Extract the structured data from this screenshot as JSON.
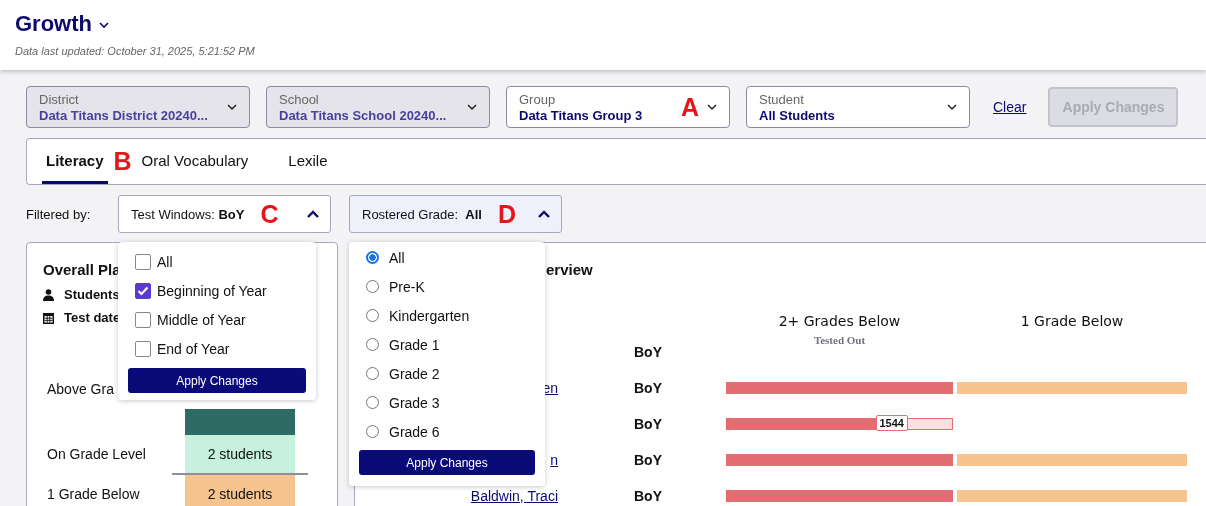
{
  "header": {
    "title": "Growth",
    "updated": "Data last updated: October 31, 2025, 5:21:52 PM"
  },
  "selectors": [
    {
      "label": "District",
      "value": "Data Titans District 20240...",
      "disabled": true
    },
    {
      "label": "School",
      "value": "Data Titans School 20240...",
      "disabled": true
    },
    {
      "label": "Group",
      "value": "Data Titans Group 3",
      "disabled": false,
      "callout": "A"
    },
    {
      "label": "Student",
      "value": "All Students",
      "disabled": false
    }
  ],
  "clear_link": "Clear",
  "apply_button": {
    "label": "Apply Changes",
    "disabled": true
  },
  "tabs": [
    {
      "label": "Literacy",
      "selected": true,
      "callout": "B"
    },
    {
      "label": "Oral Vocabulary",
      "selected": false
    },
    {
      "label": "Lexile",
      "selected": false
    }
  ],
  "filters": {
    "label": "Filtered by:",
    "test_windows": {
      "label": "Test Windows:",
      "value": "BoY",
      "callout": "C",
      "expanded": true
    },
    "grade": {
      "label": "Rostered Grade:",
      "value": "All",
      "callout": "D",
      "expanded": true
    }
  },
  "test_window_menu": {
    "options": [
      {
        "label": "All",
        "checked": false
      },
      {
        "label": "Beginning of Year",
        "checked": true
      },
      {
        "label": "Middle of Year",
        "checked": false
      },
      {
        "label": "End of Year",
        "checked": false
      }
    ],
    "button": "Apply Changes"
  },
  "grade_menu": {
    "options": [
      {
        "label": "All",
        "selected": true
      },
      {
        "label": "Pre-K",
        "selected": false
      },
      {
        "label": "Kindergarten",
        "selected": false
      },
      {
        "label": "Grade 1",
        "selected": false
      },
      {
        "label": "Grade 2",
        "selected": false
      },
      {
        "label": "Grade 3",
        "selected": false
      },
      {
        "label": "Grade 6",
        "selected": false
      }
    ],
    "button": "Apply Changes"
  },
  "placement": {
    "title": "Overall Pla",
    "students_label": "Students",
    "test_date_label": "Test date",
    "levels": [
      {
        "label": "Above Gra",
        "color": "#2e6b65"
      },
      {
        "label": "On Grade Level",
        "count": "2 students",
        "color": "#c6f1de"
      },
      {
        "label": "1 Grade Below",
        "count": "2 students",
        "color": "#f6c48f"
      }
    ]
  },
  "overview": {
    "title": "erview",
    "columns": [
      "2+ Grades Below",
      "1 Grade Below"
    ],
    "rows": [
      {
        "kind": "note",
        "window": "BoY",
        "note": "Tested Out"
      },
      {
        "kind": "bars",
        "name": "en",
        "window": "BoY",
        "bars": [
          {
            "level": 1
          },
          {
            "level": 1
          }
        ]
      },
      {
        "kind": "bars",
        "window": "BoY",
        "bars": [
          {
            "level": 0.66,
            "score": "1544"
          }
        ]
      },
      {
        "kind": "bars",
        "name": "n",
        "window": "BoY",
        "bars": [
          {
            "level": 1
          },
          {
            "level": 1
          }
        ]
      },
      {
        "kind": "bars",
        "name": "Baldwin, Traci",
        "window": "BoY",
        "bars": [
          {
            "level": 1
          },
          {
            "level": 1
          }
        ]
      }
    ]
  }
}
